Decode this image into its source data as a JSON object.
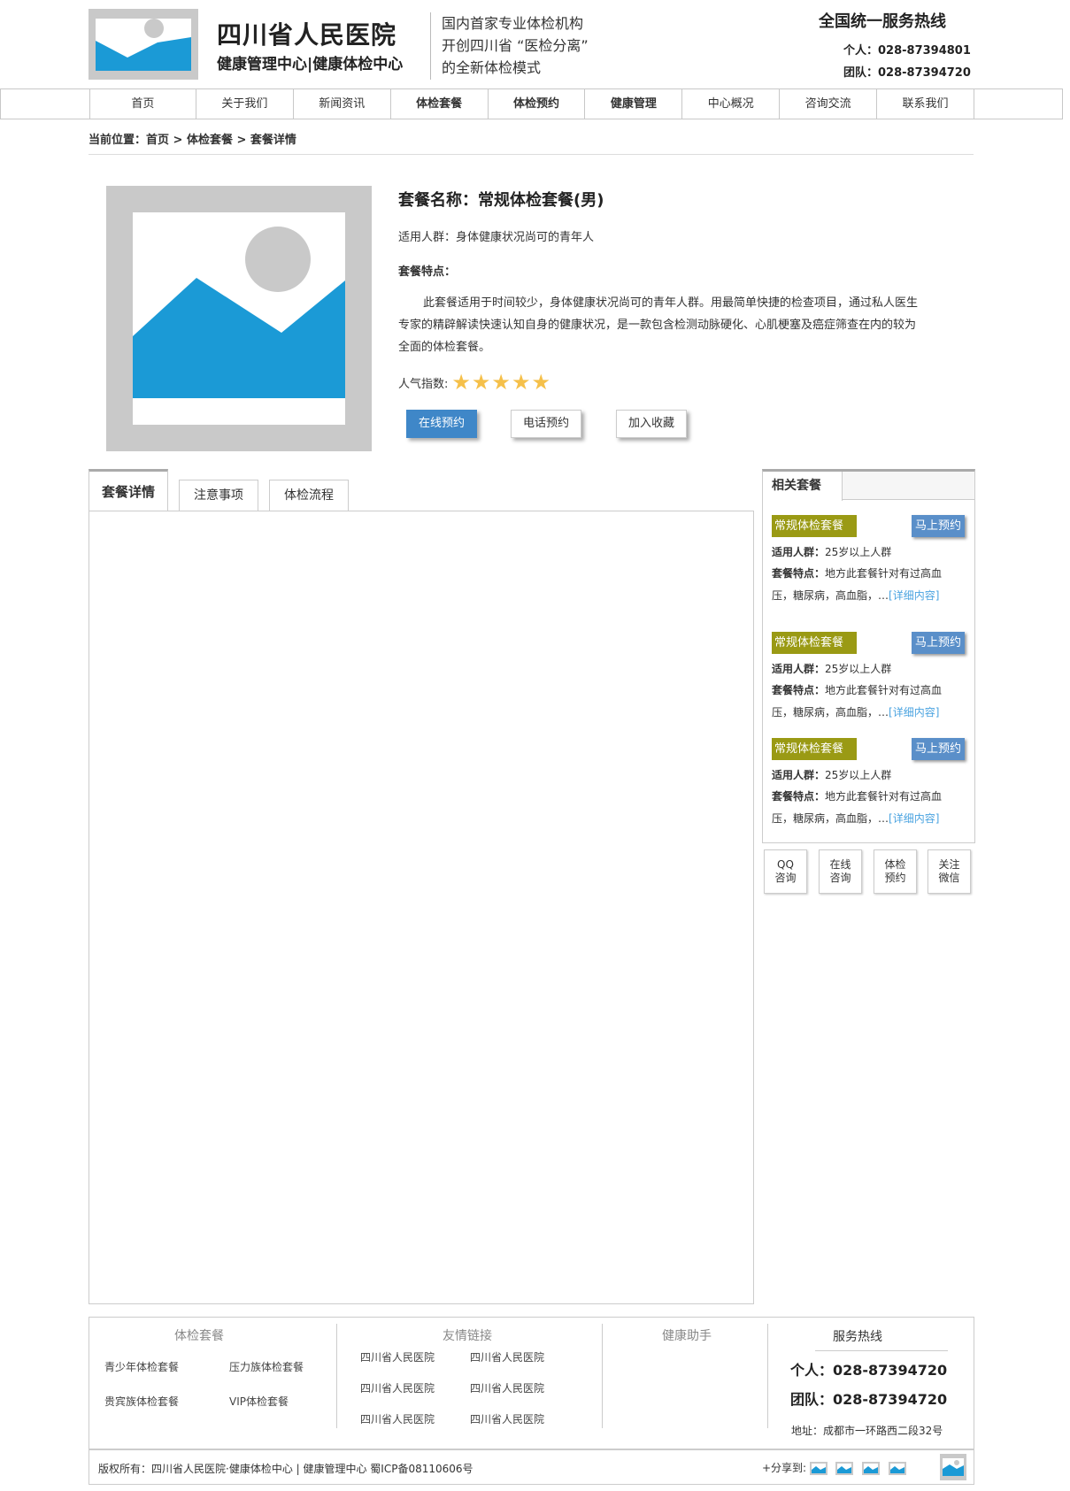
{
  "header": {
    "hospital_name": "四川省人民医院",
    "hospital_sub": "健康管理中心|健康体检中心",
    "slogan": [
      "国内首家专业体检机构",
      "开创四川省 “医检分离”",
      "的全新体检模式"
    ],
    "hotline_title": "全国统一服务热线",
    "hotline_personal": "个人：028-87394801",
    "hotline_team": "团队：028-87394720",
    "logo_icon": "placeholder-image-icon"
  },
  "nav": {
    "items": [
      {
        "label": "首页",
        "bold": false
      },
      {
        "label": "关于我们",
        "bold": false
      },
      {
        "label": "新闻资讯",
        "bold": false
      },
      {
        "label": "体检套餐",
        "bold": true
      },
      {
        "label": "体检预约",
        "bold": true
      },
      {
        "label": "健康管理",
        "bold": true
      },
      {
        "label": "中心概况",
        "bold": false
      },
      {
        "label": "咨询交流",
        "bold": false
      },
      {
        "label": "联系我们",
        "bold": false
      }
    ]
  },
  "breadcrumb": "当前位置：首页 > 体检套餐 > 套餐详情",
  "product": {
    "title": "套餐名称：常规体检套餐(男)",
    "crowd": "适用人群：身体健康状况尚可的青年人",
    "features_label": "套餐特点：",
    "description": "此套餐适用于时间较少，身体健康状况尚可的青年人群。用最简单快捷的检查项目，通过私人医生专家的精辟解读快速认知自身的健康状况，是一款包含检测动脉硬化、心肌梗塞及癌症筛查在内的较为全面的体检套餐。",
    "popularity_label": "人气指数:",
    "popularity_stars": 5,
    "star_color": "#f5c04a",
    "buttons": {
      "online": "在线预约",
      "phone": "电话预约",
      "favorite": "加入收藏"
    },
    "accent_color": "#3f87c8"
  },
  "tabs": [
    "套餐详情",
    "注意事项",
    "体检流程"
  ],
  "sidebar": {
    "title": "相关套餐",
    "packages": [
      {
        "name": "常规体检套餐",
        "book": "马上预约",
        "crowd_label": "适用人群：",
        "crowd": "25岁以上人群",
        "feature_label": "套餐特点：",
        "feature_1": "地方此套餐针对有过高血",
        "feature_2": "压，糖尿病，高血脂，…",
        "more": "[详细内容]"
      },
      {
        "name": "常规体检套餐",
        "book": "马上预约",
        "crowd_label": "适用人群：",
        "crowd": "25岁以上人群",
        "feature_label": "套餐特点：",
        "feature_1": "地方此套餐针对有过高血",
        "feature_2": "压，糖尿病，高血脂，…",
        "more": "[详细内容]"
      },
      {
        "name": "常规体检套餐",
        "book": "马上预约",
        "crowd_label": "适用人群：",
        "crowd": "25岁以上人群",
        "feature_label": "套餐特点：",
        "feature_1": "地方此套餐针对有过高血",
        "feature_2": "压，糖尿病，高血脂，…",
        "more": "[详细内容]"
      }
    ],
    "icons": [
      {
        "line1": "QQ",
        "line2": "咨询"
      },
      {
        "line1": "在线",
        "line2": "咨询"
      },
      {
        "line1": "体检",
        "line2": "预约"
      },
      {
        "line1": "关注",
        "line2": "微信"
      }
    ]
  },
  "footer": {
    "col1_title": "体检套餐",
    "col1_links": [
      "青少年体检套餐",
      "压力族体检套餐",
      "贵宾族体检套餐",
      "VIP体检套餐"
    ],
    "col2_title": "友情链接",
    "col2_links": [
      "四川省人民医院",
      "四川省人民医院",
      "四川省人民医院",
      "四川省人民医院",
      "四川省人民医院",
      "四川省人民医院"
    ],
    "col3_title": "健康助手",
    "hot_title": "服务热线",
    "hot_personal": "个人：028-87394720",
    "hot_team": "团队：028-87394720",
    "address": "地址：成都市一环路西二段32号",
    "copyright": "版权所有：四川省人民医院·健康体检中心  |  健康管理中心    蜀ICP备08110606号",
    "share_label": "+分享到:"
  },
  "colors": {
    "placeholder_gray": "#c9c9c9",
    "placeholder_blue": "#1b9ad6",
    "olive": "#9a9a14",
    "book_blue": "#5a8fc9",
    "link_blue": "#4aa3e0"
  }
}
